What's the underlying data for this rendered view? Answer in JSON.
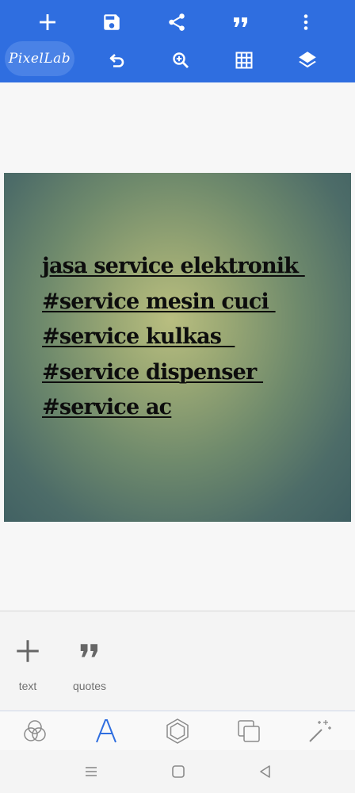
{
  "app": {
    "logo": "PixelLab"
  },
  "toolbar": {
    "row1": [
      "add-icon",
      "save-icon",
      "share-icon",
      "quote-icon",
      "more-vert-icon"
    ],
    "row2": [
      "undo-icon",
      "zoom-in-icon",
      "grid-icon",
      "layers-icon"
    ],
    "color": "#2f6ee0"
  },
  "canvas": {
    "lines": [
      "jasa service elektronik ",
      "#service mesin cuci ",
      "#service kulkas  ",
      "#service dispenser ",
      "#service ac"
    ]
  },
  "panel": {
    "items": [
      {
        "label": "text",
        "icon": "plus-icon"
      },
      {
        "label": "quotes",
        "icon": "quote-icon"
      }
    ]
  },
  "tabs": {
    "items": [
      "color-blend-icon",
      "text-tool-icon",
      "shape-icon",
      "layer-copy-icon",
      "magic-wand-icon"
    ],
    "active": "text-tool-icon",
    "accent": "#2f6ee0"
  },
  "system_nav": [
    "recents-icon",
    "home-icon",
    "back-icon"
  ]
}
